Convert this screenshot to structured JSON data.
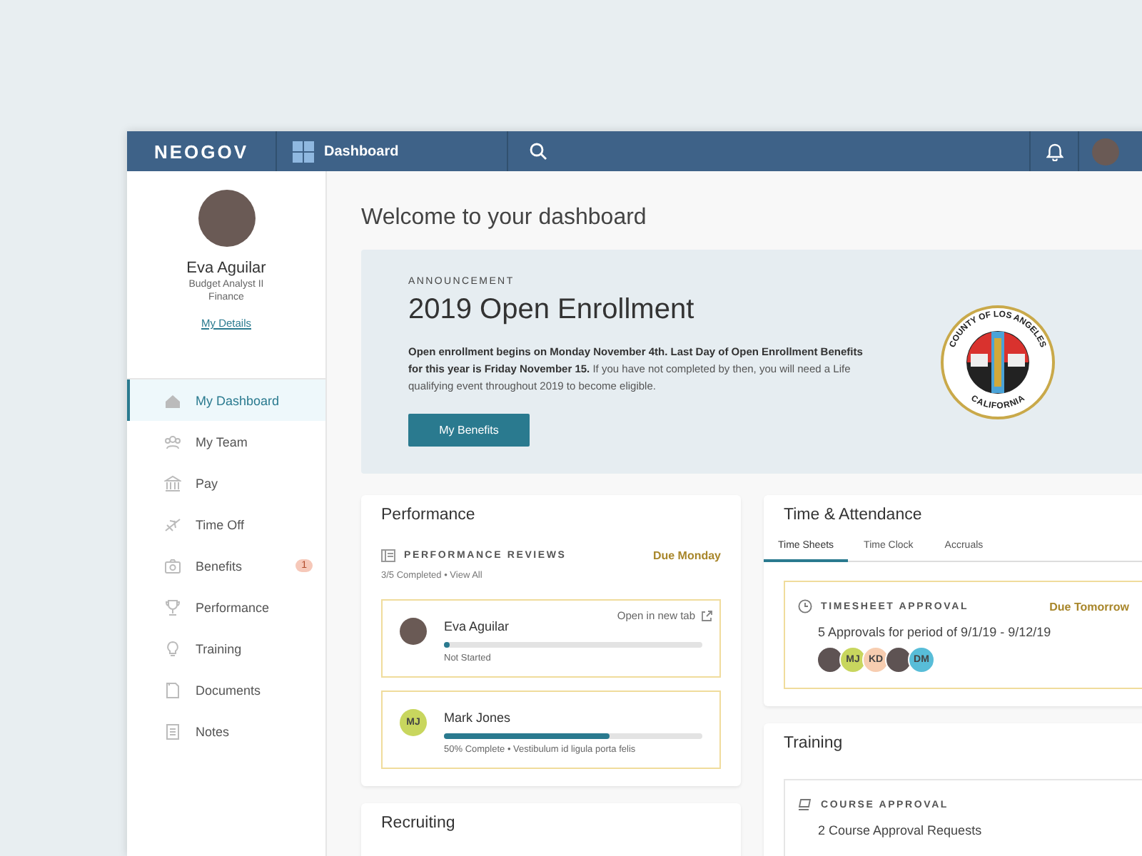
{
  "topbar": {
    "logo": "NEOGOV",
    "app": "Dashboard"
  },
  "profile": {
    "name": "Eva Aguilar",
    "title": "Budget Analyst II",
    "department": "Finance",
    "link": "My Details"
  },
  "nav": [
    {
      "label": "My Dashboard",
      "selected": true
    },
    {
      "label": "My Team",
      "selected": false
    },
    {
      "label": "Pay",
      "selected": false
    },
    {
      "label": "Time Off",
      "selected": false
    },
    {
      "label": "Benefits",
      "selected": false,
      "badge": "1"
    },
    {
      "label": "Performance",
      "selected": false
    },
    {
      "label": "Training",
      "selected": false
    },
    {
      "label": "Documents",
      "selected": false
    },
    {
      "label": "Notes",
      "selected": false
    }
  ],
  "heading": "Welcome to your dashboard",
  "announcement": {
    "eyebrow": "ANNOUNCEMENT",
    "title": "2019 Open Enrollment",
    "body": "**Open enrollment begins on Monday November 4th. Last Day of Open Enrollment Benefits for this year is Friday November 15.** If you have not completed by then, you will need a Life qualifying event throughout 2019 to become eligible.",
    "button": "My Benefits",
    "seal": {
      "top_text": "COUNTY OF LOS ANGELES",
      "bottom_text": "CALIFORNIA"
    }
  },
  "performance": {
    "title": "Performance",
    "section": "PERFORMANCE REVIEWS",
    "due": "Due Monday",
    "summary": "3/5 Completed • View All",
    "reviews": [
      {
        "name": "Eva Aguilar",
        "avatar": {
          "kind": "photo"
        },
        "level": 0.02,
        "status": "Not Started",
        "open_link": "Open in new tab"
      },
      {
        "name": "Mark Jones",
        "avatar": {
          "kind": "initials",
          "initials": "MJ",
          "color": "#c8d65e"
        },
        "level": 0.64,
        "status": "50% Complete • Vestibulum id ligula porta felis"
      }
    ]
  },
  "recruiting": {
    "title": "Recruiting"
  },
  "time": {
    "title": "Time & Attendance",
    "tabs": [
      {
        "label": "Time Sheets",
        "selected": true
      },
      {
        "label": "Time Clock",
        "selected": false
      },
      {
        "label": "Accruals",
        "selected": false
      }
    ],
    "approval": {
      "label": "TIMESHEET APPROVAL",
      "due": "Due Tomorrow",
      "text": "5 Approvals for period of 9/1/19 - 9/12/19",
      "avatars": [
        {
          "kind": "photo"
        },
        {
          "kind": "initials",
          "initials": "MJ",
          "color": "#c8d65e"
        },
        {
          "kind": "initials",
          "initials": "KD",
          "color": "#f7cdb0"
        },
        {
          "kind": "photo"
        },
        {
          "kind": "initials",
          "initials": "DM",
          "color": "#58bdd8"
        }
      ]
    }
  },
  "training": {
    "title": "Training",
    "label": "COURSE APPROVAL",
    "text": "2 Course Approval Requests"
  }
}
